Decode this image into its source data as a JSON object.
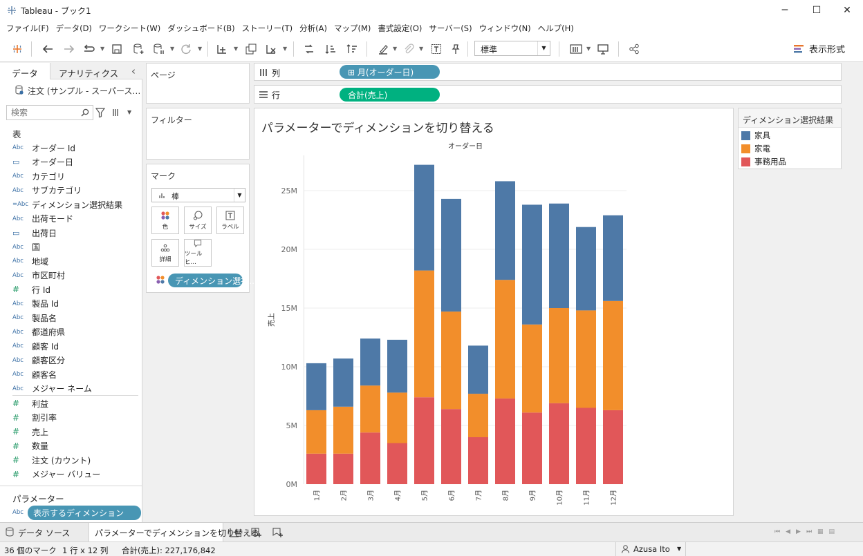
{
  "window": {
    "title": "Tableau - ブック1",
    "minimize": "─",
    "maximize": "☐",
    "close": "✕"
  },
  "menu": [
    "ファイル(F)",
    "データ(D)",
    "ワークシート(W)",
    "ダッシュボード(B)",
    "ストーリー(T)",
    "分析(A)",
    "マップ(M)",
    "書式設定(O)",
    "サーバー(S)",
    "ウィンドウ(N)",
    "ヘルプ(H)"
  ],
  "toolbar": {
    "fit_value": "標準",
    "show_me_label": "表示形式"
  },
  "datapane": {
    "tab_data": "データ",
    "tab_analytics": "アナリティクス",
    "collapse": "‹",
    "datasource": "注文 (サンプル - スーパース…",
    "search_placeholder": "検索",
    "tables_header": "表",
    "dimensions": [
      {
        "type": "Abc",
        "name": "オーダー Id"
      },
      {
        "type": "cal",
        "name": "オーダー日"
      },
      {
        "type": "Abc",
        "name": "カテゴリ"
      },
      {
        "type": "Abc",
        "name": "サブカテゴリ"
      },
      {
        "type": "=Abc",
        "name": "ディメンション選択結果"
      },
      {
        "type": "Abc",
        "name": "出荷モード"
      },
      {
        "type": "cal",
        "name": "出荷日"
      },
      {
        "type": "Abc",
        "name": "国"
      },
      {
        "type": "Abc",
        "name": "地域"
      },
      {
        "type": "Abc",
        "name": "市区町村"
      },
      {
        "type": "#",
        "name": "行 Id"
      },
      {
        "type": "Abc",
        "name": "製品 Id"
      },
      {
        "type": "Abc",
        "name": "製品名"
      },
      {
        "type": "Abc",
        "name": "都道府県"
      },
      {
        "type": "Abc",
        "name": "顧客 Id"
      },
      {
        "type": "Abc",
        "name": "顧客区分"
      },
      {
        "type": "Abc",
        "name": "顧客名"
      },
      {
        "type": "Abc",
        "name": "メジャー ネーム"
      }
    ],
    "measures": [
      {
        "type": "#",
        "name": "利益"
      },
      {
        "type": "#",
        "name": "割引率"
      },
      {
        "type": "#",
        "name": "売上"
      },
      {
        "type": "#",
        "name": "数量"
      },
      {
        "type": "#",
        "name": "注文 (カウント)"
      },
      {
        "type": "#",
        "name": "メジャー バリュー"
      }
    ],
    "parameters_header": "パラメーター",
    "parameter": {
      "type": "Abc",
      "name": "表示するディメンション"
    }
  },
  "shelves": {
    "pages": "ページ",
    "filters": "フィルター",
    "marks": "マーク",
    "mark_type": "棒",
    "mark_buttons": [
      "色",
      "サイズ",
      "ラベル",
      "詳細",
      "ツールヒ…"
    ],
    "color_pill": "ディメンション選択…",
    "columns_label": "列",
    "columns_pill": "⊞ 月(オーダー日)",
    "rows_label": "行",
    "rows_pill": "合計(売上)"
  },
  "colors": {
    "furniture": "#4e79a7",
    "electronics": "#f28e2b",
    "office": "#e15759",
    "pill_dim": "#4896b4",
    "pill_meas": "#00b180"
  },
  "chart_data": {
    "type": "bar",
    "stacked": true,
    "title": "パラメーターでディメンションを切り替える",
    "xlabel": "オーダー日",
    "ylabel": "売上",
    "categories": [
      "1月",
      "2月",
      "3月",
      "4月",
      "5月",
      "6月",
      "7月",
      "8月",
      "9月",
      "10月",
      "11月",
      "12月"
    ],
    "series": [
      {
        "name": "事務用品",
        "values": [
          2.6,
          2.6,
          4.4,
          3.5,
          7.4,
          6.4,
          4.0,
          7.3,
          6.1,
          6.9,
          6.5,
          6.3
        ]
      },
      {
        "name": "家電",
        "values": [
          3.7,
          4.0,
          4.0,
          4.3,
          10.8,
          8.3,
          3.7,
          10.1,
          7.5,
          8.1,
          8.3,
          9.3
        ]
      },
      {
        "name": "家具",
        "values": [
          4.0,
          4.1,
          4.0,
          4.5,
          9.0,
          9.6,
          4.1,
          8.4,
          10.2,
          8.9,
          7.1,
          7.3
        ]
      }
    ],
    "yticks": [
      "0M",
      "5M",
      "10M",
      "15M",
      "20M",
      "25M"
    ],
    "ylim": [
      0,
      28
    ],
    "unit": "M",
    "legend_title": "ディメンション選択結果",
    "legend": [
      "家具",
      "家電",
      "事務用品"
    ]
  },
  "tabs": {
    "datasource": "データ ソース",
    "sheet": "パラメーターでディメンションを切り替える"
  },
  "status": {
    "marks": "36 個のマーク",
    "rows_cols": "1 行 x 12 列",
    "sum": "合計(売上): 227,176,842",
    "user": "Azusa Ito"
  }
}
